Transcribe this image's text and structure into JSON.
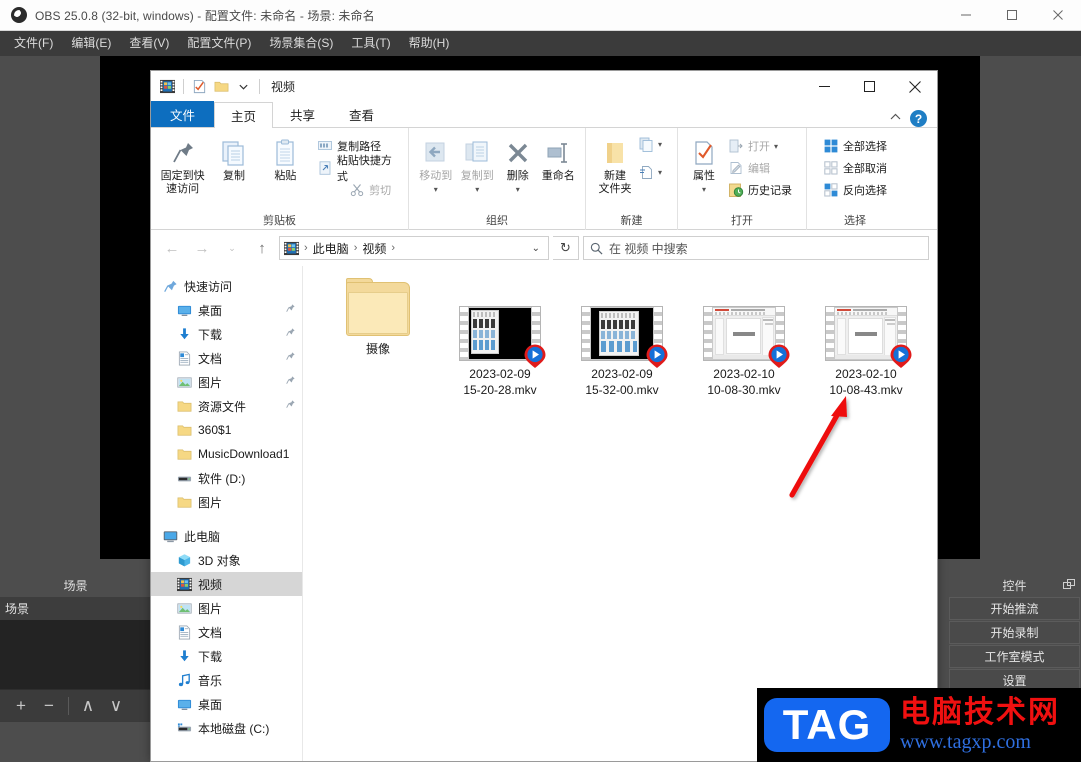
{
  "obs": {
    "title": "OBS 25.0.8 (32-bit, windows) - 配置文件: 未命名 - 场景: 未命名",
    "window_buttons": {
      "minimize": "—",
      "maximize": "□",
      "close": "✕"
    },
    "menu": [
      "文件(F)",
      "编辑(E)",
      "查看(V)",
      "配置文件(P)",
      "场景集合(S)",
      "工具(T)",
      "帮助(H)"
    ],
    "scenes_dock": {
      "title": "场景",
      "items": [
        "场景"
      ],
      "toolbar": [
        "+",
        "−",
        "∧",
        "∨"
      ]
    },
    "controls_dock": {
      "title": "控件",
      "buttons": [
        "开始推流",
        "开始录制",
        "工作室模式",
        "设置"
      ]
    }
  },
  "explorer": {
    "title": "视频",
    "quick_access_icons": [
      "video-folder-icon",
      "properties-icon",
      "new-folder-icon",
      "qat-dropdown-icon"
    ],
    "window_buttons": {
      "minimize": "—",
      "maximize": "□",
      "close": "✕"
    },
    "tabs": [
      {
        "label": "文件",
        "kind": "file"
      },
      {
        "label": "主页",
        "kind": "active"
      },
      {
        "label": "共享",
        "kind": "normal"
      },
      {
        "label": "查看",
        "kind": "normal"
      }
    ],
    "help_label": "?",
    "ribbon": {
      "groups": [
        {
          "label": "剪贴板",
          "big": [
            {
              "label": "固定到快\n速访问",
              "icon": "pin-icon",
              "dim": false
            },
            {
              "label": "复制",
              "icon": "copy-icon",
              "dim": false
            },
            {
              "label": "粘贴",
              "icon": "paste-icon",
              "dim": false
            }
          ],
          "small": [
            {
              "label": "复制路径",
              "icon": "copy-path-icon",
              "dim": false
            },
            {
              "label": "粘贴快捷方式",
              "icon": "paste-shortcut-icon",
              "dim": false
            },
            {
              "label": "剪切",
              "icon": "scissors-icon",
              "dim": true
            }
          ]
        },
        {
          "label": "组织",
          "big": [
            {
              "label": "移动到",
              "icon": "move-to-icon",
              "dim": true
            },
            {
              "label": "复制到",
              "icon": "copy-to-icon",
              "dim": true
            },
            {
              "label": "删除",
              "icon": "delete-x-icon",
              "dim": false
            },
            {
              "label": "重命名",
              "icon": "rename-icon",
              "dim": false
            }
          ],
          "small": []
        },
        {
          "label": "新建",
          "big": [
            {
              "label": "新建\n文件夹",
              "icon": "new-folder-icon",
              "dim": false
            }
          ],
          "small": [
            {
              "label": "",
              "icon": "new-item-icon",
              "dim": false
            },
            {
              "label": "",
              "icon": "easy-access-icon",
              "dim": false
            }
          ]
        },
        {
          "label": "打开",
          "big": [
            {
              "label": "属性",
              "icon": "properties-icon",
              "dim": false
            }
          ],
          "small": [
            {
              "label": "打开",
              "icon": "open-icon",
              "dim": true
            },
            {
              "label": "编辑",
              "icon": "edit-icon",
              "dim": true
            },
            {
              "label": "历史记录",
              "icon": "history-icon",
              "dim": false
            }
          ]
        },
        {
          "label": "选择",
          "big": [],
          "small": [
            {
              "label": "全部选择",
              "icon": "select-all-icon",
              "dim": false
            },
            {
              "label": "全部取消",
              "icon": "select-none-icon",
              "dim": false
            },
            {
              "label": "反向选择",
              "icon": "invert-selection-icon",
              "dim": false
            }
          ]
        }
      ]
    },
    "address": {
      "back": "←",
      "forward": "→",
      "recent": "∨",
      "up": "↑",
      "crumbs": [
        "此电脑",
        "视频"
      ],
      "refresh": "↻",
      "search_placeholder": "在 视频 中搜索"
    },
    "nav": [
      {
        "label": "快速访问",
        "icon": "star-pin-icon",
        "level": 0,
        "pinned": false,
        "selected": false
      },
      {
        "label": "桌面",
        "icon": "desktop-icon",
        "level": 1,
        "pinned": true,
        "selected": false
      },
      {
        "label": "下载",
        "icon": "download-icon",
        "level": 1,
        "pinned": true,
        "selected": false
      },
      {
        "label": "文档",
        "icon": "documents-icon",
        "level": 1,
        "pinned": true,
        "selected": false
      },
      {
        "label": "图片",
        "icon": "pictures-icon",
        "level": 1,
        "pinned": true,
        "selected": false
      },
      {
        "label": "资源文件",
        "icon": "folder-icon",
        "level": 1,
        "pinned": true,
        "selected": false
      },
      {
        "label": "360$1",
        "icon": "folder-icon",
        "level": 1,
        "pinned": false,
        "selected": false
      },
      {
        "label": "MusicDownload1",
        "icon": "folder-icon",
        "level": 1,
        "pinned": false,
        "selected": false
      },
      {
        "label": "软件 (D:)",
        "icon": "drive-icon",
        "level": 1,
        "pinned": false,
        "selected": false
      },
      {
        "label": "图片",
        "icon": "folder-icon",
        "level": 1,
        "pinned": false,
        "selected": false
      },
      {
        "label": "此电脑",
        "icon": "this-pc-icon",
        "level": 0,
        "pinned": false,
        "selected": false
      },
      {
        "label": "3D 对象",
        "icon": "3d-objects-icon",
        "level": 1,
        "pinned": false,
        "selected": false
      },
      {
        "label": "视频",
        "icon": "videos-icon",
        "level": 1,
        "pinned": false,
        "selected": true
      },
      {
        "label": "图片",
        "icon": "pictures-icon",
        "level": 1,
        "pinned": false,
        "selected": false
      },
      {
        "label": "文档",
        "icon": "documents-icon",
        "level": 1,
        "pinned": false,
        "selected": false
      },
      {
        "label": "下载",
        "icon": "download-icon",
        "level": 1,
        "pinned": false,
        "selected": false
      },
      {
        "label": "音乐",
        "icon": "music-icon",
        "level": 1,
        "pinned": false,
        "selected": false
      },
      {
        "label": "桌面",
        "icon": "desktop-icon",
        "level": 1,
        "pinned": false,
        "selected": false
      },
      {
        "label": "本地磁盘 (C:)",
        "icon": "drive-icon",
        "level": 1,
        "pinned": false,
        "selected": false
      }
    ],
    "files": [
      {
        "name": "摄像",
        "type": "folder"
      },
      {
        "name": "2023-02-09\n15-20-28.mkv",
        "type": "video"
      },
      {
        "name": "2023-02-09\n15-32-00.mkv",
        "type": "video"
      },
      {
        "name": "2023-02-10\n10-08-30.mkv",
        "type": "video"
      },
      {
        "name": "2023-02-10\n10-08-43.mkv",
        "type": "video"
      }
    ]
  },
  "watermark": {
    "tag": "TAG",
    "site_cn": "电脑技术网",
    "url": "www.tagxp.com"
  },
  "colors": {
    "obs_chrome": "#4d4d4d",
    "obs_menubar": "#3b3b3b",
    "explorer_accent": "#0d6ebf",
    "annotation_red": "#ee1111",
    "watermark_blue": "#1467f0"
  }
}
